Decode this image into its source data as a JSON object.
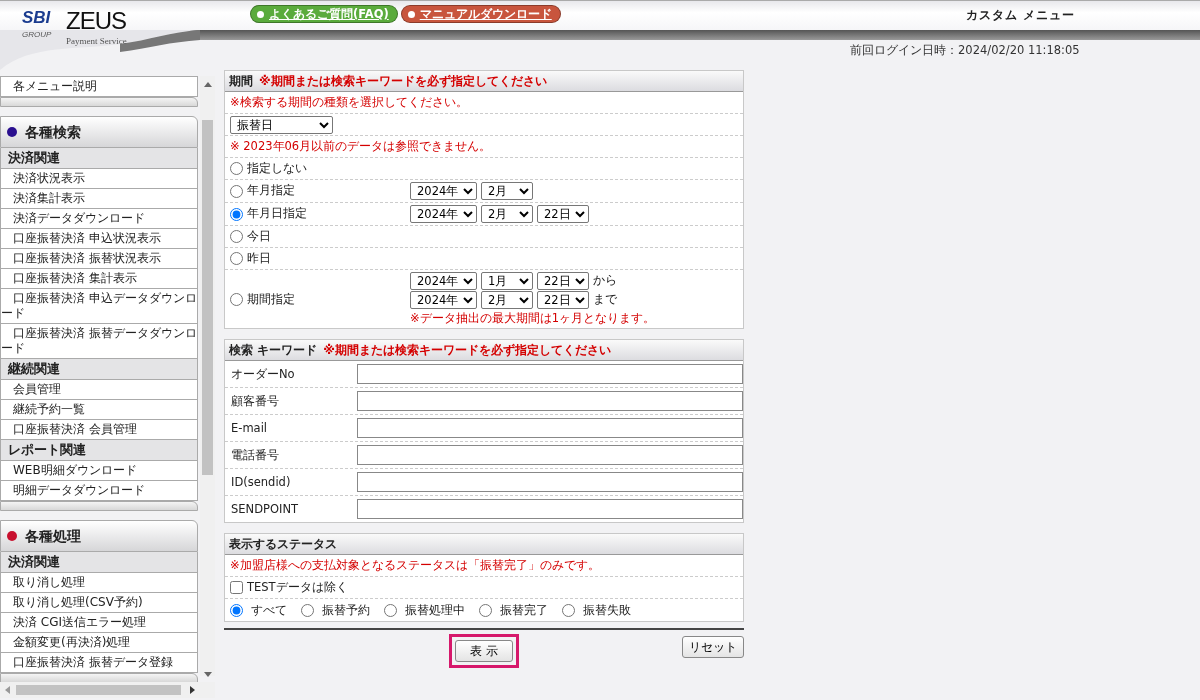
{
  "header": {
    "logo": {
      "brand": "SBI",
      "group": "GROUP",
      "name": "ZEUS",
      "tagline": "Payment Service"
    },
    "links": [
      {
        "label": "よくあるご質問(FAQ)",
        "color": "#5aab3c"
      },
      {
        "label": "マニュアルダウンロード",
        "color": "#c8553d"
      }
    ],
    "title": "カスタム メニュー",
    "last_login": "前回ログイン日時：2024/02/20 11:18:05"
  },
  "sidebar": {
    "top_items": [
      "各メニュー説明"
    ],
    "groups": [
      {
        "title": "各種検索",
        "color": "#2a0f8f",
        "sections": [
          {
            "title": "決済関連",
            "items": [
              "決済状況表示",
              "決済集計表示",
              "決済データダウンロード",
              "口座振替決済 申込状況表示",
              "口座振替決済 振替状況表示",
              "口座振替決済 集計表示",
              "口座振替決済 申込データダウンロード",
              "口座振替決済 振替データダウンロード"
            ]
          },
          {
            "title": "継続関連",
            "items": [
              "会員管理",
              "継続予約一覧",
              "口座振替決済 会員管理"
            ]
          },
          {
            "title": "レポート関連",
            "items": [
              "WEB明細ダウンロード",
              "明細データダウンロード"
            ]
          }
        ]
      },
      {
        "title": "各種処理",
        "color": "#c8102e",
        "sections": [
          {
            "title": "決済関連",
            "items": [
              "取り消し処理",
              "取り消し処理(CSV予約)",
              "決済 CGI送信エラー処理",
              "金額変更(再決済)処理",
              "口座振替決済 振替データ登録"
            ]
          }
        ]
      }
    ]
  },
  "period": {
    "title": "期間",
    "required": "※期間または検索キーワードを必ず指定してください",
    "note": "※検索する期間の種類を選択してください。",
    "type_select": "振替日",
    "warning": "※ 2023年06月以前のデータは参照できません。",
    "options": [
      {
        "label": "指定しない",
        "selected": false
      },
      {
        "label": "年月指定",
        "selected": false,
        "ranges": [
          {
            "selects": [
              "2024年",
              "2月"
            ]
          }
        ]
      },
      {
        "label": "年月日指定",
        "selected": true,
        "ranges": [
          {
            "selects": [
              "2024年",
              "2月",
              "22日"
            ]
          }
        ]
      },
      {
        "label": "今日",
        "selected": false
      },
      {
        "label": "昨日",
        "selected": false
      },
      {
        "label": "期間指定",
        "selected": false,
        "ranges": [
          {
            "selects": [
              "2024年",
              "1月",
              "22日"
            ],
            "suffix": "から"
          },
          {
            "selects": [
              "2024年",
              "2月",
              "22日"
            ],
            "suffix": "まで"
          }
        ],
        "note": "※データ抽出の最大期間は1ヶ月となります。"
      }
    ]
  },
  "keyword": {
    "title": "検索 キーワード",
    "required": "※期間または検索キーワードを必ず指定してください",
    "fields": [
      {
        "label": "オーダーNo"
      },
      {
        "label": "顧客番号"
      },
      {
        "label": "E-mail"
      },
      {
        "label": "電話番号"
      },
      {
        "label": "ID(sendid)"
      },
      {
        "label": "SENDPOINT"
      }
    ]
  },
  "status": {
    "title": "表示するステータス",
    "note": "※加盟店様への支払対象となるステータスは「振替完了」のみです。",
    "exclude_test": {
      "label": "TESTデータは除く",
      "checked": false
    },
    "options": [
      {
        "label": "すべて",
        "selected": true
      },
      {
        "label": "振替予約",
        "selected": false
      },
      {
        "label": "振替処理中",
        "selected": false
      },
      {
        "label": "振替完了",
        "selected": false
      },
      {
        "label": "振替失敗",
        "selected": false
      }
    ]
  },
  "buttons": {
    "submit": {
      "label": "表 示",
      "highlighted": true
    },
    "reset": {
      "label": "リセット"
    }
  }
}
